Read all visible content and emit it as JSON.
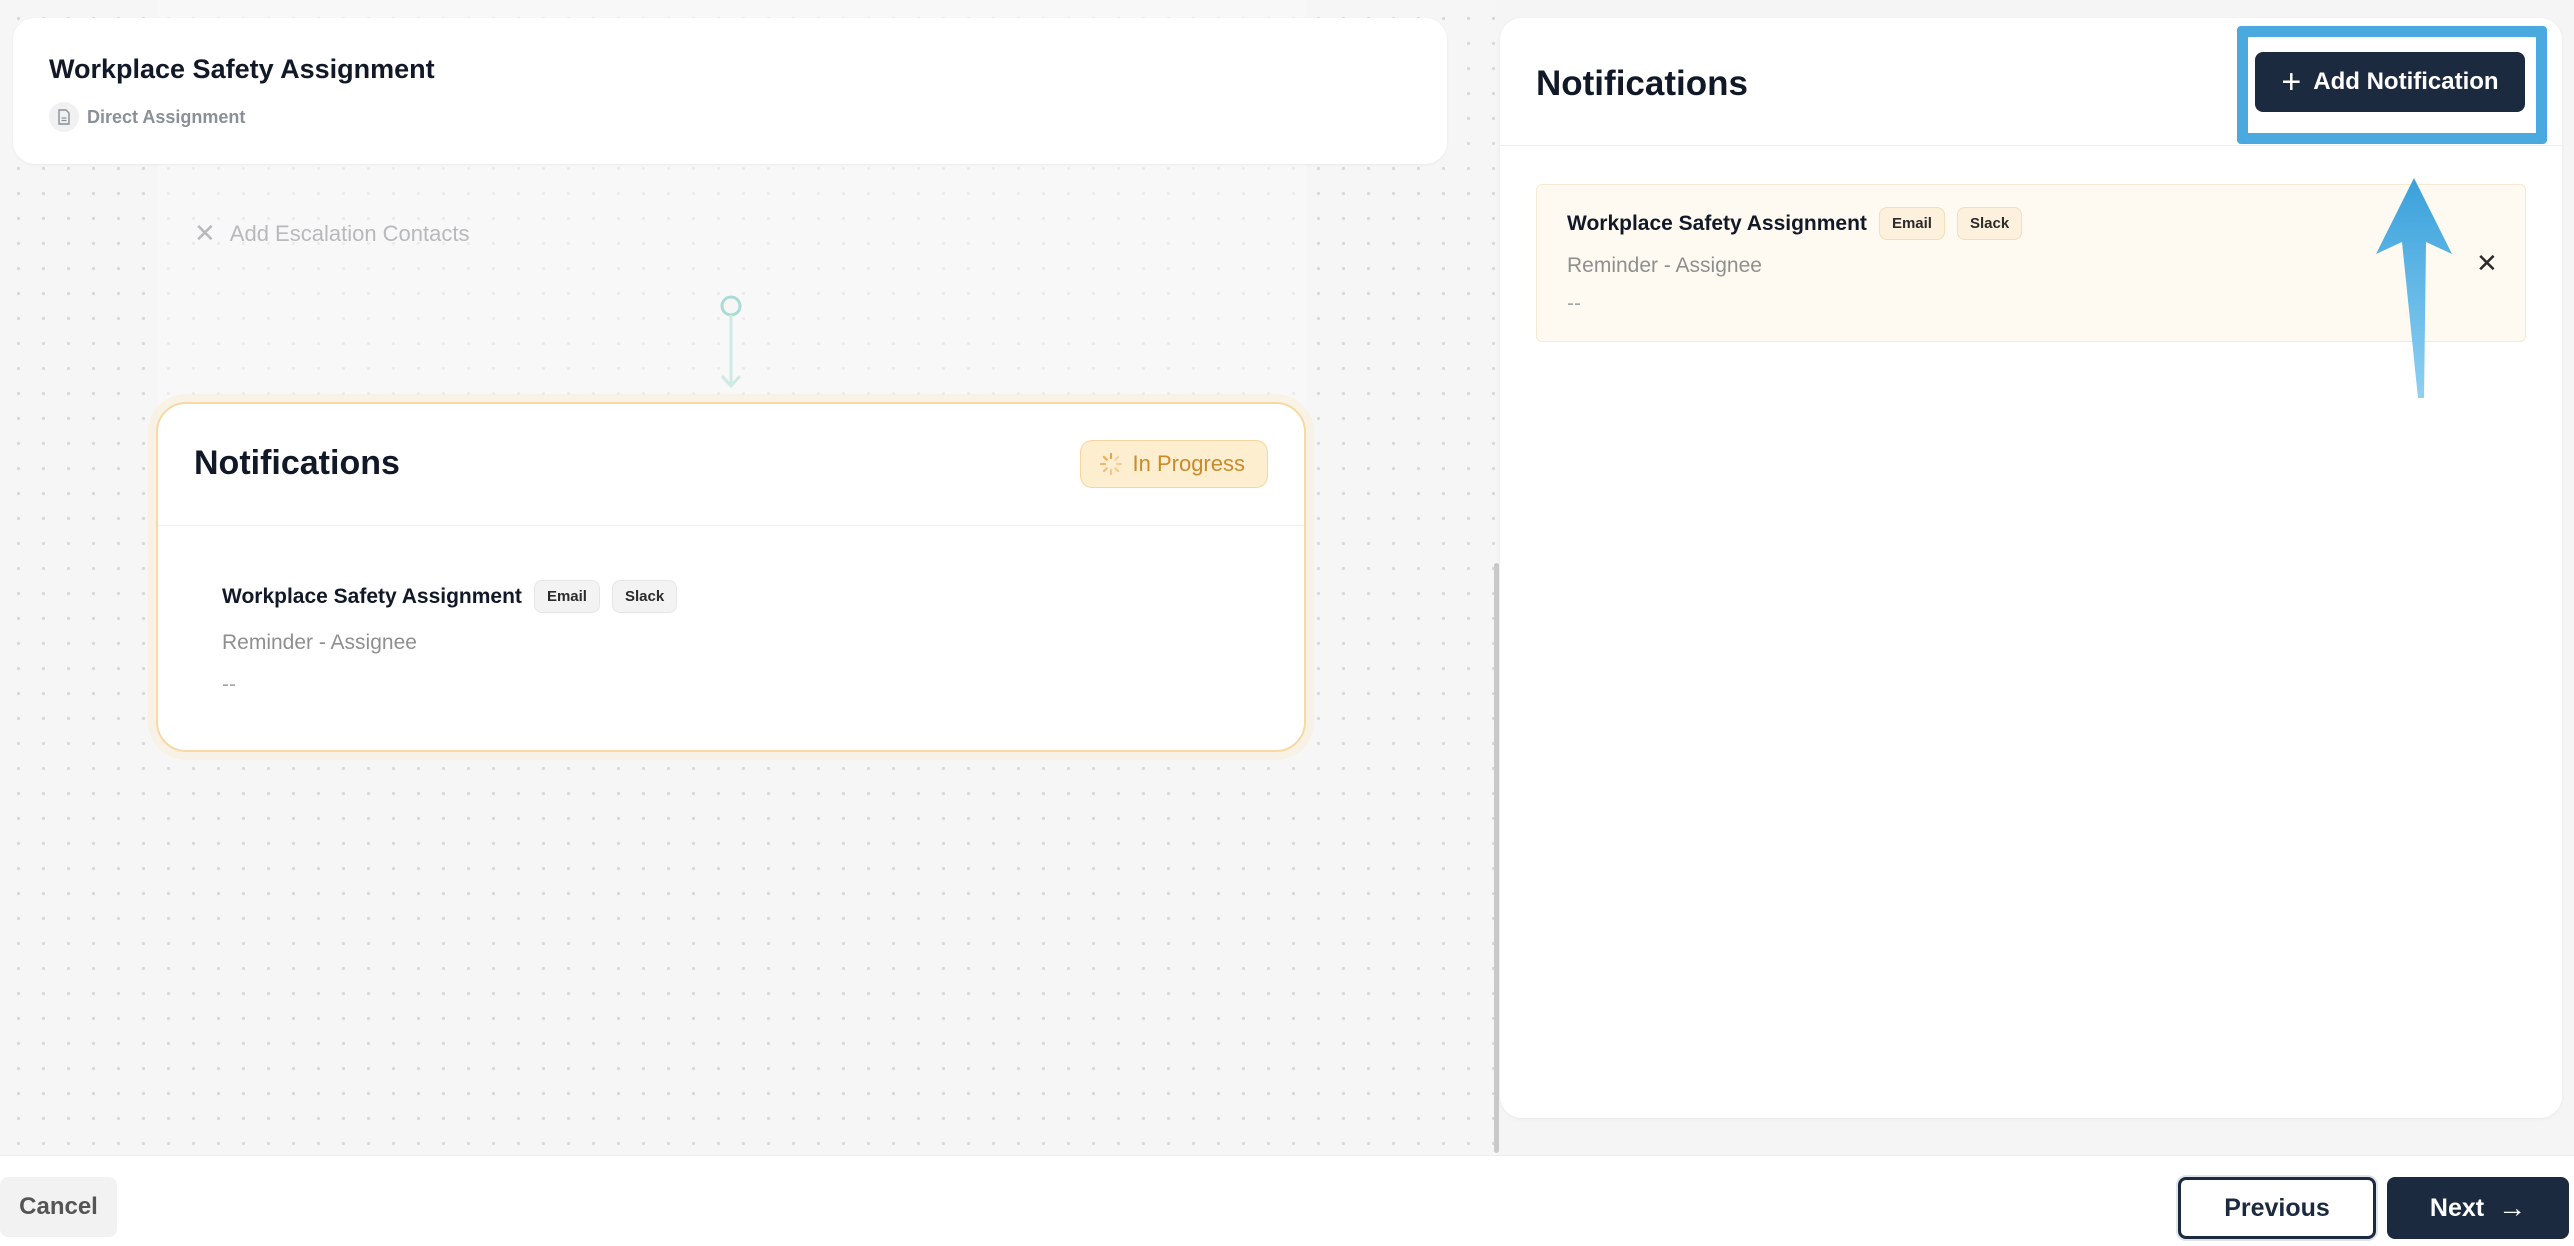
{
  "header": {
    "title": "Workplace Safety Assignment",
    "subtitle": "Direct Assignment"
  },
  "canvas": {
    "ghost_label": "Add Escalation Contacts",
    "node": {
      "title": "Notifications",
      "status": "In Progress",
      "items": [
        {
          "name": "Workplace Safety Assignment",
          "channels": [
            "Email",
            "Slack"
          ],
          "type": "Reminder - Assignee",
          "extra": "--"
        }
      ]
    }
  },
  "side_panel": {
    "title": "Notifications",
    "add_label": "Add Notification",
    "items": [
      {
        "name": "Workplace Safety Assignment",
        "channels": [
          "Email",
          "Slack"
        ],
        "type": "Reminder - Assignee",
        "extra": "--"
      }
    ]
  },
  "footer": {
    "cancel_label": "Cancel",
    "previous_label": "Previous",
    "next_label": "Next"
  },
  "colors": {
    "primary": "#1c2a40",
    "highlight": "#4aa9de",
    "progress_bg": "#fdeecf",
    "progress_text": "#c98a2c"
  },
  "icons": {
    "add": "plus-icon",
    "remove": "close-icon",
    "next": "arrow-right-icon",
    "status": "spinner-icon",
    "subtitle": "document-icon"
  }
}
